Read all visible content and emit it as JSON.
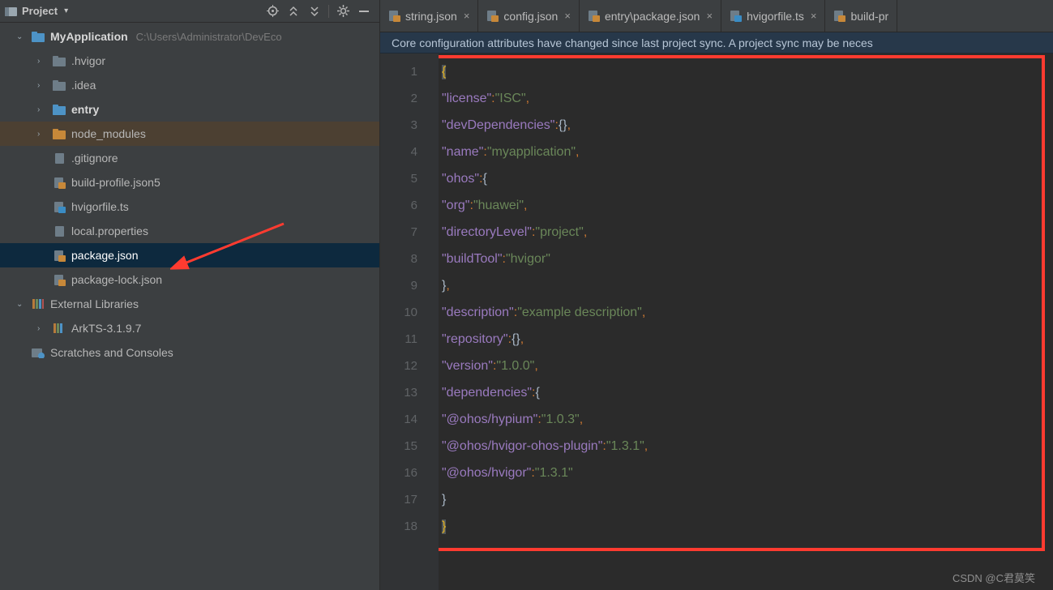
{
  "toolbar": {
    "label": "Project",
    "dropdown_caret": "▾"
  },
  "tree": {
    "root": {
      "name": "MyApplication",
      "path_hint": "C:\\Users\\Administrator\\DevEco"
    },
    "children": [
      {
        "name": ".hvigor",
        "type": "folder"
      },
      {
        "name": ".idea",
        "type": "folder"
      },
      {
        "name": "entry",
        "type": "folder-blue",
        "bold": true
      },
      {
        "name": "node_modules",
        "type": "folder-orange"
      },
      {
        "name": ".gitignore",
        "type": "file"
      },
      {
        "name": "build-profile.json5",
        "type": "json"
      },
      {
        "name": "hvigorfile.ts",
        "type": "ts"
      },
      {
        "name": "local.properties",
        "type": "file"
      },
      {
        "name": "package.json",
        "type": "json",
        "selected": true
      },
      {
        "name": "package-lock.json",
        "type": "json"
      }
    ],
    "ext_lib_label": "External Libraries",
    "ext_libs": [
      {
        "name": "ArkTS-3.1.9.7"
      }
    ],
    "scratches_label": "Scratches and Consoles"
  },
  "tabs": [
    {
      "label": "string.json",
      "type": "json"
    },
    {
      "label": "config.json",
      "type": "json"
    },
    {
      "label": "entry\\package.json",
      "type": "json"
    },
    {
      "label": "hvigorfile.ts",
      "type": "ts"
    },
    {
      "label": "build-pr",
      "type": "json",
      "truncated": true
    }
  ],
  "banner": "Core configuration attributes have changed since last project sync. A project sync may be neces",
  "editor": {
    "line_count": 18,
    "bulb_line": 2,
    "content": {
      "license": "ISC",
      "devDependencies": {},
      "name": "myapplication",
      "ohos": {
        "org": "huawei",
        "directoryLevel": "project",
        "buildTool": "hvigor"
      },
      "description": "example description",
      "repository": {},
      "version": "1.0.0",
      "dependencies": {
        "@ohos/hypium": "1.0.3",
        "@ohos/hvigor-ohos-plugin": "1.3.1",
        "@ohos/hvigor": "1.3.1"
      }
    }
  },
  "watermark": "CSDN @C君莫笑"
}
